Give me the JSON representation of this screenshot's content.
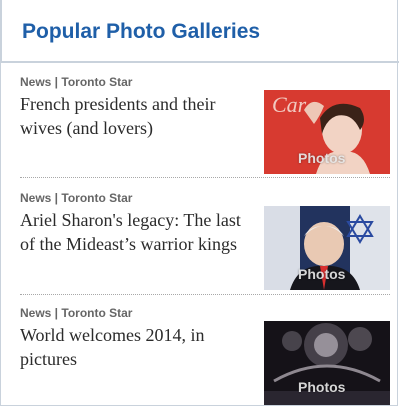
{
  "widget": {
    "title": "Popular Photo Galleries"
  },
  "items": [
    {
      "source": "News | Toronto Star",
      "headline": "French presidents and their wives (and lovers)",
      "thumb_badge": "Photos"
    },
    {
      "source": "News | Toronto Star",
      "headline": "Ariel Sharon's legacy: The last of the Mideast’s warrior kings",
      "thumb_badge": "Photos"
    },
    {
      "source": "News | Toronto Star",
      "headline": "World welcomes 2014, in pictures",
      "thumb_badge": "Photos"
    }
  ]
}
